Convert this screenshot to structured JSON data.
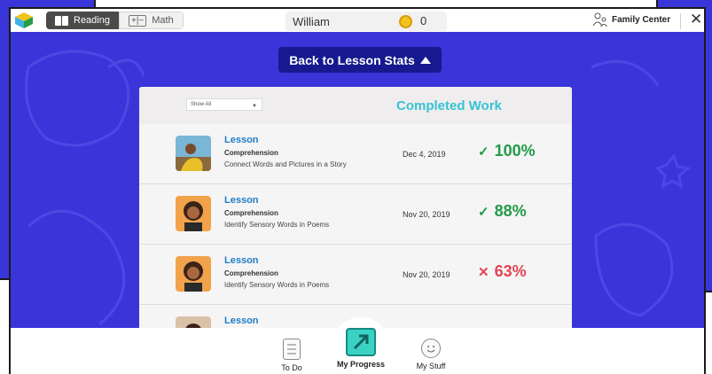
{
  "subjects": [
    {
      "label": "Reading",
      "active": true
    },
    {
      "label": "Math",
      "active": false
    }
  ],
  "user": {
    "name": "William",
    "coins": "0"
  },
  "header": {
    "family_center": "Family Center",
    "close": "✕"
  },
  "back_button": "Back to Lesson Stats",
  "filter": {
    "value": "Show All"
  },
  "panel_title": "Completed Work",
  "lessons": [
    {
      "title": "Lesson",
      "category": "Comprehension",
      "description": "Connect Words and Pictures in a Story",
      "date": "Dec 4, 2019",
      "score": "100%",
      "mark": "✓",
      "status": "pass"
    },
    {
      "title": "Lesson",
      "category": "Comprehension",
      "description": "Identify Sensory Words in Poems",
      "date": "Nov 20, 2019",
      "score": "88%",
      "mark": "✓",
      "status": "pass"
    },
    {
      "title": "Lesson",
      "category": "Comprehension",
      "description": "Identify Sensory Words in Poems",
      "date": "Nov 20, 2019",
      "score": "63%",
      "mark": "✕",
      "status": "fail"
    },
    {
      "title": "Lesson"
    }
  ],
  "bottom_nav": [
    {
      "label": "To Do",
      "icon": "todo-list-icon"
    },
    {
      "label": "My Progress",
      "icon": "progress-arrow-icon",
      "active": true
    },
    {
      "label": "My Stuff",
      "icon": "smiley-icon"
    }
  ],
  "colors": {
    "brand_blue": "#3a35d8",
    "button_navy": "#161a8e",
    "title_teal": "#36c3d3",
    "pass_green": "#1f9b47",
    "fail_red": "#e24553"
  }
}
